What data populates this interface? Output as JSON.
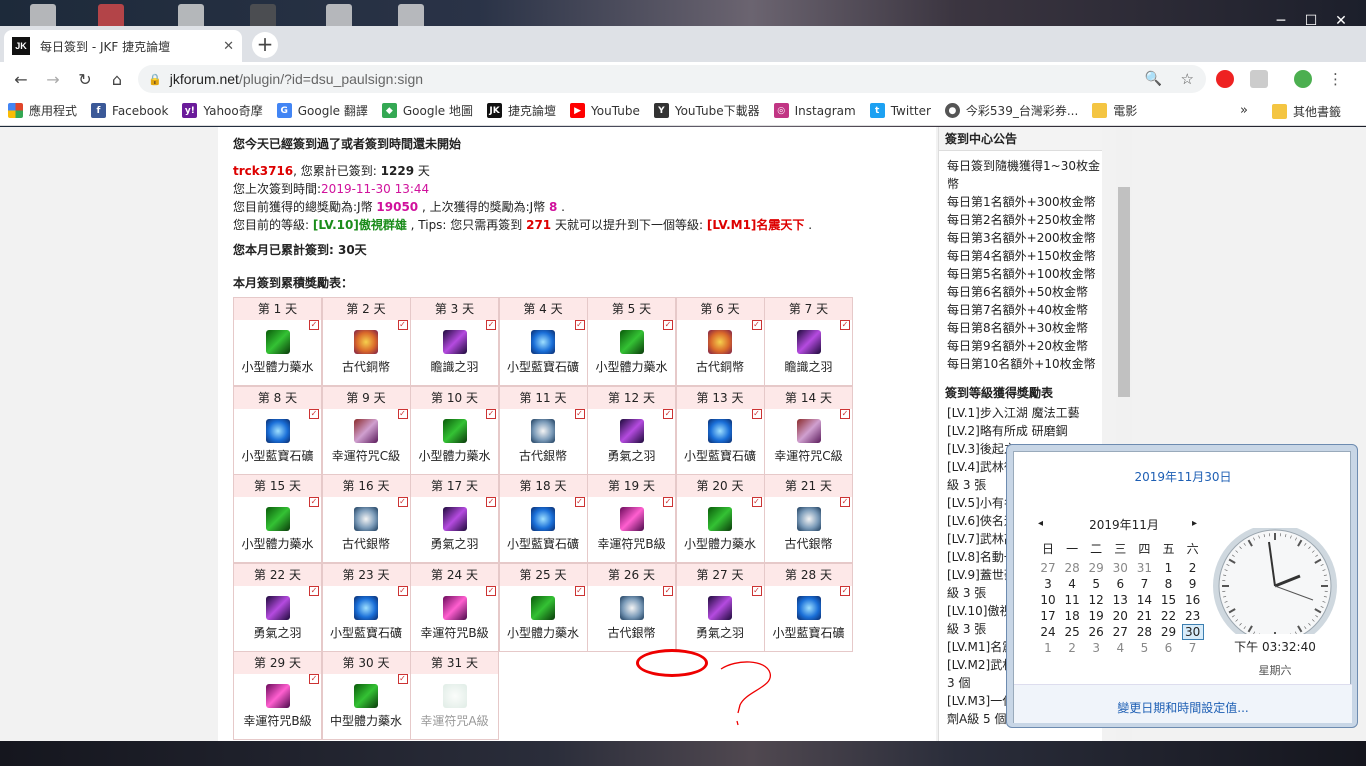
{
  "browser": {
    "tab_title": "每日簽到 - JKF 捷克論壇",
    "tab_logo": "JK",
    "new_tab": "+",
    "url_host": "jkforum.net",
    "url_path": "/plugin/?id=dsu_paulsign:sign",
    "icons": [
      "back-icon",
      "forward-icon",
      "reload-icon",
      "home-icon",
      "lock-icon",
      "zoom-icon",
      "star-icon",
      "menu-icon"
    ],
    "window_buttons": [
      "─",
      "☐",
      "✕"
    ]
  },
  "bookmarks": [
    {
      "label": "應用程式",
      "color": "#e0452a"
    },
    {
      "label": "Facebook",
      "color": "#3b5998",
      "glyph": "f"
    },
    {
      "label": "Yahoo奇摩",
      "color": "#6a1b9a",
      "glyph": "y!"
    },
    {
      "label": "Google 翻譯",
      "color": "#4285f4",
      "glyph": "G"
    },
    {
      "label": "Google 地圖",
      "color": "#34a853",
      "glyph": "◆"
    },
    {
      "label": "捷克論壇",
      "color": "#111111",
      "glyph": "JK"
    },
    {
      "label": "YouTube",
      "color": "#ff0000",
      "glyph": "▶"
    },
    {
      "label": "YouTube下載器",
      "color": "#333333",
      "glyph": "Y"
    },
    {
      "label": "Instagram",
      "color": "#c13584",
      "glyph": "◎"
    },
    {
      "label": "Twitter",
      "color": "#1da1f2",
      "glyph": "t"
    },
    {
      "label": "今彩539_台灣彩券...",
      "color": "#555555",
      "glyph": "●"
    },
    {
      "label": "電影",
      "color": "#f4c542",
      "glyph": ""
    }
  ],
  "bookmarks_more": "»",
  "bookmarks_other": "其他書籤",
  "sign": {
    "status": "您今天已經簽到過了或者簽到時間還未開始",
    "user": "trck3716",
    "total_prefix": ", 您累計已簽到: ",
    "total_days": "1229",
    "total_suffix": " 天",
    "last_prefix": "您上次簽到時間:",
    "last_time": "2019-11-30 13:44",
    "reward_prefix": "您目前獲得的總獎勵為:J幣 ",
    "reward_total": "19050",
    "reward_mid": " , 上次獲得的獎勵為:J幣 ",
    "reward_last": "8",
    "reward_end": " .",
    "level_prefix": "您目前的等級: ",
    "level_cur": "[LV.10]傲視群雄",
    "level_mid": " , Tips: 您只需再簽到 ",
    "level_need": "271",
    "level_mid2": " 天就可以提升到下一個等級: ",
    "level_next": "[LV.M1]名震天下",
    "level_end": " .",
    "month_total": "您本月已累計簽到: 30天",
    "table_title": "本月簽到累積獎勵表："
  },
  "days": [
    {
      "day": "第 1 天",
      "item": "小型體力藥水",
      "icon": "green",
      "checked": true
    },
    {
      "day": "第 2 天",
      "item": "古代銅幣",
      "icon": "coin",
      "checked": true
    },
    {
      "day": "第 3 天",
      "item": "瞻識之羽",
      "icon": "feather",
      "checked": true
    },
    {
      "day": "第 4 天",
      "item": "小型藍寶石礦",
      "icon": "gem",
      "checked": true
    },
    {
      "day": "第 5 天",
      "item": "小型體力藥水",
      "icon": "green",
      "checked": true
    },
    {
      "day": "第 6 天",
      "item": "古代銅幣",
      "icon": "coin",
      "checked": true
    },
    {
      "day": "第 7 天",
      "item": "瞻識之羽",
      "icon": "feather",
      "checked": true
    },
    {
      "day": "第 8 天",
      "item": "小型藍寶石礦",
      "icon": "gem",
      "checked": true
    },
    {
      "day": "第 9 天",
      "item": "幸運符咒C級",
      "icon": "talc",
      "checked": true
    },
    {
      "day": "第 10 天",
      "item": "小型體力藥水",
      "icon": "green",
      "checked": true
    },
    {
      "day": "第 11 天",
      "item": "古代銀幣",
      "icon": "silver",
      "checked": true
    },
    {
      "day": "第 12 天",
      "item": "勇氣之羽",
      "icon": "feather",
      "checked": true
    },
    {
      "day": "第 13 天",
      "item": "小型藍寶石礦",
      "icon": "gem",
      "checked": true
    },
    {
      "day": "第 14 天",
      "item": "幸運符咒C級",
      "icon": "talc",
      "checked": true
    },
    {
      "day": "第 15 天",
      "item": "小型體力藥水",
      "icon": "green",
      "checked": true
    },
    {
      "day": "第 16 天",
      "item": "古代銀幣",
      "icon": "silver",
      "checked": true
    },
    {
      "day": "第 17 天",
      "item": "勇氣之羽",
      "icon": "feather",
      "checked": true
    },
    {
      "day": "第 18 天",
      "item": "小型藍寶石礦",
      "icon": "gem",
      "checked": true
    },
    {
      "day": "第 19 天",
      "item": "幸運符咒B級",
      "icon": "talb",
      "checked": true
    },
    {
      "day": "第 20 天",
      "item": "小型體力藥水",
      "icon": "green",
      "checked": true
    },
    {
      "day": "第 21 天",
      "item": "古代銀幣",
      "icon": "silver",
      "checked": true
    },
    {
      "day": "第 22 天",
      "item": "勇氣之羽",
      "icon": "feather",
      "checked": true
    },
    {
      "day": "第 23 天",
      "item": "小型藍寶石礦",
      "icon": "gem",
      "checked": true
    },
    {
      "day": "第 24 天",
      "item": "幸運符咒B級",
      "icon": "talb",
      "checked": true
    },
    {
      "day": "第 25 天",
      "item": "小型體力藥水",
      "icon": "green",
      "checked": true
    },
    {
      "day": "第 26 天",
      "item": "古代銀幣",
      "icon": "silver",
      "checked": true
    },
    {
      "day": "第 27 天",
      "item": "勇氣之羽",
      "icon": "feather",
      "checked": true
    },
    {
      "day": "第 28 天",
      "item": "小型藍寶石礦",
      "icon": "gem",
      "checked": true
    },
    {
      "day": "第 29 天",
      "item": "幸運符咒B級",
      "icon": "talb",
      "checked": true
    },
    {
      "day": "第 30 天",
      "item": "中型體力藥水",
      "icon": "green",
      "checked": true
    },
    {
      "day": "第 31 天",
      "item": "幸運符咒A級",
      "icon": "tala",
      "checked": false
    }
  ],
  "sidebar": {
    "notice_title": "簽到中心公告",
    "notice_lines": [
      "每日簽到隨機獲得1~30枚金",
      "幣",
      "每日第1名額外+300枚金幣",
      "每日第2名額外+250枚金幣",
      "每日第3名額外+200枚金幣",
      "每日第4名額外+150枚金幣",
      "每日第5名額外+100枚金幣",
      "每日第6名額外+50枚金幣",
      "每日第7名額外+40枚金幣",
      "每日第8名額外+30枚金幣",
      "每日第9名額外+20枚金幣",
      "每日第10名額外+10枚金幣"
    ],
    "level_title": "簽到等級獲得獎勵表",
    "level_lines": [
      "[LV.1]步入江湖 魔法工藝",
      "[LV.2]略有所成 研磨鋼",
      "[LV.3]後起之",
      "[LV.4]武林後",
      "級 3 張",
      "[LV.5]小有名",
      "[LV.6]俠名遠",
      "[LV.7]武林高",
      "[LV.8]名動一",
      "[LV.9]蓋世豪",
      "級 3 張",
      "[LV.10]傲視",
      "級 3 張",
      "[LV.M1]名震",
      "[LV.M2]武林",
      "3 個",
      "[LV.M3]一代",
      "劑A級 5 個"
    ]
  },
  "popup": {
    "date_title": "2019年11月30日",
    "prev": "◂",
    "next": "▸",
    "month": "2019年11月",
    "weekdays": [
      "日",
      "一",
      "二",
      "三",
      "四",
      "五",
      "六"
    ],
    "weeks": [
      [
        "27",
        "28",
        "29",
        "30",
        "31",
        "1",
        "2"
      ],
      [
        "3",
        "4",
        "5",
        "6",
        "7",
        "8",
        "9"
      ],
      [
        "10",
        "11",
        "12",
        "13",
        "14",
        "15",
        "16"
      ],
      [
        "17",
        "18",
        "19",
        "20",
        "21",
        "22",
        "23"
      ],
      [
        "24",
        "25",
        "26",
        "27",
        "28",
        "29",
        "30"
      ],
      [
        "1",
        "2",
        "3",
        "4",
        "5",
        "6",
        "7"
      ]
    ],
    "time": "下午 03:32:40",
    "weekday": "星期六",
    "footer_link": "變更日期和時間設定值..."
  }
}
